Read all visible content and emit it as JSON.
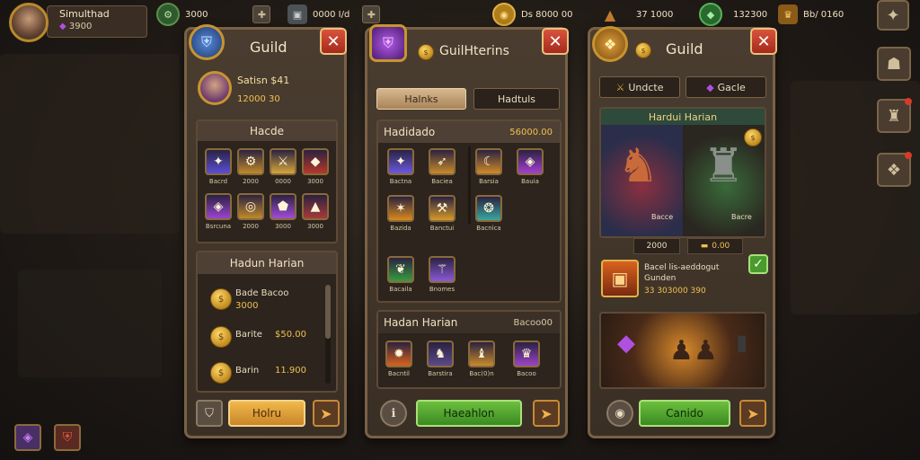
{
  "player": {
    "name": "Simulthad",
    "sub": "3900"
  },
  "resources": [
    {
      "icon": "green-coin-icon",
      "value": "3000",
      "color": "#3d9b42"
    },
    {
      "icon": "stone-icon",
      "value": "0000 I/d",
      "color": "#6a6f74"
    },
    {
      "icon": "gold-coin-icon",
      "value": "Ds 8000 00",
      "color": "#c99222"
    },
    {
      "icon": "bronze-triangle-icon",
      "value": "37 1000",
      "color": "#b06a2c"
    },
    {
      "icon": "emerald-icon",
      "value": "132300",
      "color": "#3aa64a"
    },
    {
      "icon": "treasure-icon",
      "value": "Bb/ 0160",
      "color": "#d69a2a"
    }
  ],
  "panel1": {
    "title": "Guild",
    "member": {
      "name": "Satisn $41",
      "line2": "12000   30"
    },
    "section1": {
      "title": "Hacde",
      "items": [
        {
          "label": "Bacrd",
          "color": "#5a4fd6",
          "icon": "crossbow-icon"
        },
        {
          "label": "2000",
          "color": "#c08a2a",
          "icon": "gear-icon"
        },
        {
          "label": "0000",
          "color": "#d6a73a",
          "icon": "swords-icon"
        },
        {
          "label": "3000",
          "color": "#b6382a",
          "icon": "gem-icon"
        },
        {
          "label": "Bsrcuna",
          "color": "#9a44d0",
          "icon": "crystal-icon"
        },
        {
          "label": "2000",
          "color": "#c08a2a",
          "icon": "ring-icon"
        },
        {
          "label": "3000",
          "color": "#a14cd8",
          "icon": "potion-icon"
        },
        {
          "label": "3000",
          "color": "#a63a3a",
          "icon": "shard-icon"
        }
      ]
    },
    "section2": {
      "title": "Hadun Harian",
      "rows": [
        {
          "label": "Bade Bacoo",
          "line2": "3000"
        },
        {
          "label": "Barite",
          "value": "$50.00"
        },
        {
          "label": "Barin",
          "value": "11.900"
        }
      ]
    },
    "button": "Holru"
  },
  "panel2": {
    "title": "GuilHterins",
    "tabs": [
      "Halnks",
      "Hadtuls"
    ],
    "section1": {
      "title": "Hadidado",
      "value": "56000.00",
      "items": [
        {
          "label": "Bactna",
          "color": "#6b5ae0",
          "icon": "crossbow-icon"
        },
        {
          "label": "Baciea",
          "color": "#c88a2a",
          "icon": "spear-icon"
        },
        {
          "label": "Barsia",
          "color": "#d08a2a",
          "icon": "horn-icon"
        },
        {
          "label": "Bauia",
          "color": "#a540d0",
          "icon": "crystal-icon"
        },
        {
          "label": "Bazida",
          "color": "#d98a1e",
          "icon": "claw-icon"
        },
        {
          "label": "Banctui",
          "color": "#d69a2a",
          "icon": "axe-icon"
        },
        {
          "label": "Bacnica",
          "color": "#3aa6a0",
          "icon": "bow-icon"
        },
        {
          "label": "Bacaila",
          "color": "#3a9a42",
          "icon": "leaf-icon"
        },
        {
          "label": "Bnomes",
          "color": "#8a5ad8",
          "icon": "wand-icon"
        }
      ]
    },
    "section2": {
      "title": "Hadan Harian",
      "value": "Bacoo00",
      "items": [
        {
          "label": "Bacntil",
          "color": "#d8621e",
          "icon": "fire-icon"
        },
        {
          "label": "Barstira",
          "color": "#5a4a8a",
          "icon": "beast-icon"
        },
        {
          "label": "Bac(0)n",
          "color": "#c88a2a",
          "icon": "creature-icon"
        },
        {
          "label": "Bacoo",
          "color": "#9a44c8",
          "icon": "mage-icon"
        }
      ]
    },
    "button": "Haeahlon"
  },
  "panel3": {
    "title": "Guild",
    "tabs": [
      "Undcte",
      "Gacle"
    ],
    "banner": "Hardui Harian",
    "heroes": [
      {
        "label": "Bacce",
        "value": "2000"
      },
      {
        "label": "Bacre",
        "value": "0.00"
      }
    ],
    "reward": {
      "title": "Bacel lis-aeddogut",
      "line2": "Gunden",
      "value": "33 303000 390"
    },
    "button": "Canido"
  },
  "colors": {
    "accent_gold": "#c7942f",
    "close_red": "#c23a2a",
    "green_button": "#4a9a2e"
  }
}
